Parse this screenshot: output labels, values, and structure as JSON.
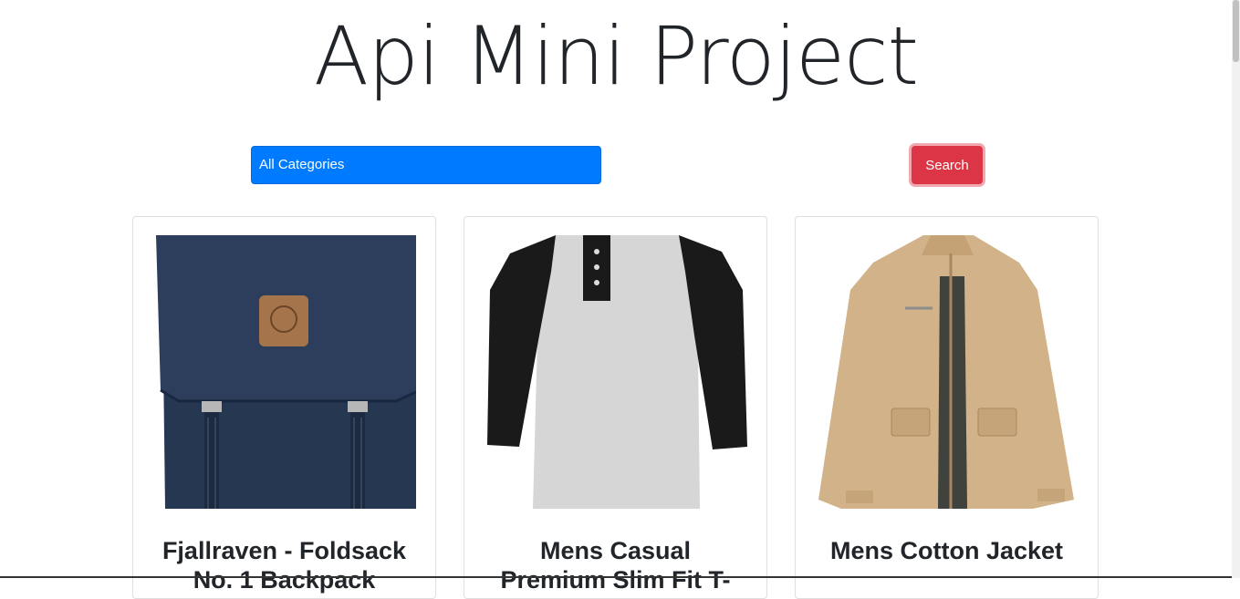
{
  "header": {
    "title": "Api Mini Project"
  },
  "filters": {
    "category_selected": "All Categories",
    "search_label": "Search"
  },
  "products": [
    {
      "title": "Fjallraven - Foldsack No. 1 Backpack"
    },
    {
      "title": "Mens Casual Premium Slim Fit T-Shirts"
    },
    {
      "title": "Mens Cotton Jacket"
    }
  ],
  "colors": {
    "primary": "#007bff",
    "danger": "#dc3545",
    "text": "#212529"
  }
}
